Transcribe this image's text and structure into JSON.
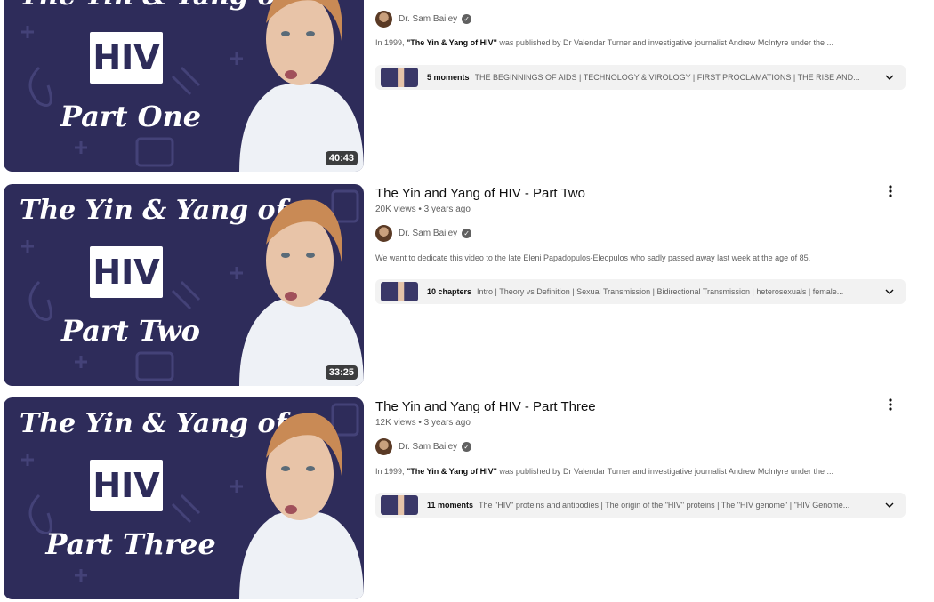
{
  "videos": [
    {
      "thumb_title": "The Yin & Yang of",
      "thumb_hiv": "HIV",
      "thumb_part": "Part One",
      "duration": "40:43",
      "channel": "Dr. Sam Bailey",
      "desc_prefix": "In 1999, ",
      "desc_bold": "\"The Yin & Yang of HIV\"",
      "desc_rest": " was published by Dr Valendar Turner and investigative journalist Andrew McIntyre under the ...",
      "chapters_count": "5 moments",
      "chapters_list": "THE BEGINNINGS OF AIDS | TECHNOLOGY & VIROLOGY | FIRST PROCLAMATIONS | THE RISE AND..."
    },
    {
      "title": "The Yin and Yang of HIV - Part Two",
      "meta": "20K views • 3 years ago",
      "thumb_title": "The Yin & Yang of",
      "thumb_hiv": "HIV",
      "thumb_part": "Part Two",
      "duration": "33:25",
      "channel": "Dr. Sam Bailey",
      "desc_prefix": "We want to dedicate this video to the late Eleni Papadopulos-Eleopulos who sadly passed away last week at the age of 85.",
      "chapters_count": "10 chapters",
      "chapters_list": "Intro | Theory vs Definition | Sexual Transmission | Bidirectional Transmission | heterosexuals | female..."
    },
    {
      "title": "The Yin and Yang of HIV - Part Three",
      "meta": "12K views • 3 years ago",
      "thumb_title": "The Yin & Yang of",
      "thumb_hiv": "HIV",
      "thumb_part": "Part Three",
      "channel": "Dr. Sam Bailey",
      "desc_prefix": "In 1999, ",
      "desc_bold": "\"The Yin & Yang of HIV\"",
      "desc_rest": " was published by Dr Valendar Turner and investigative journalist Andrew McIntyre under the ...",
      "chapters_count": "11 moments",
      "chapters_list": "The \"HIV\" proteins and antibodies | The origin of the \"HIV\" proteins | The \"HIV genome\" | \"HIV Genome..."
    }
  ],
  "icons": {
    "more": "more-vert-icon",
    "verified": "verified-check-icon",
    "expand": "chevron-down-icon"
  },
  "colors": {
    "thumbnail_bg": "#2e2c5a",
    "chapters_bg": "#f2f2f2",
    "secondary_text": "#606060"
  }
}
